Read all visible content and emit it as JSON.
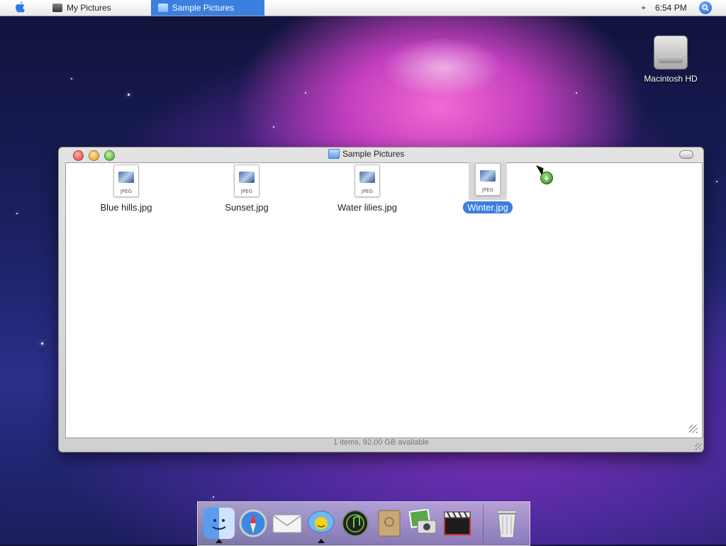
{
  "menubar": {
    "tabs": [
      {
        "label": "My Pictures",
        "icon": "camera-icon"
      },
      {
        "label": "Sample Pictures",
        "icon": "folder-icon",
        "active": true
      }
    ],
    "clock": "6:54 PM"
  },
  "desktop": {
    "icons": [
      {
        "label": "Macintosh HD",
        "icon": "hard-drive-icon"
      }
    ]
  },
  "window": {
    "title": "Sample Pictures",
    "status": "1 items, 92.00 GB available",
    "files": [
      {
        "name": "Blue hills.jpg",
        "type": "JPEG",
        "selected": false
      },
      {
        "name": "Sunset.jpg",
        "type": "JPEG",
        "selected": false
      },
      {
        "name": "Water lilies.jpg",
        "type": "JPEG",
        "selected": false
      },
      {
        "name": "Winter.jpg",
        "type": "JPEG",
        "selected": true
      }
    ]
  },
  "dock": {
    "apps": [
      {
        "name": "Finder",
        "icon": "finder-icon",
        "running": true
      },
      {
        "name": "Safari",
        "icon": "compass-icon",
        "running": false
      },
      {
        "name": "Mail",
        "icon": "mail-icon",
        "running": false
      },
      {
        "name": "iChat",
        "icon": "chat-icon",
        "running": true
      },
      {
        "name": "iTunes",
        "icon": "music-icon",
        "running": false
      },
      {
        "name": "Address Book",
        "icon": "address-book-icon",
        "running": false
      },
      {
        "name": "iPhoto",
        "icon": "photo-icon",
        "running": false
      },
      {
        "name": "iMovie",
        "icon": "clapperboard-icon",
        "running": false
      },
      {
        "name": "Trash",
        "icon": "trash-icon",
        "running": false
      }
    ]
  },
  "colors": {
    "selection": "#3b7fe0",
    "menubar": "#f0f0f0"
  }
}
